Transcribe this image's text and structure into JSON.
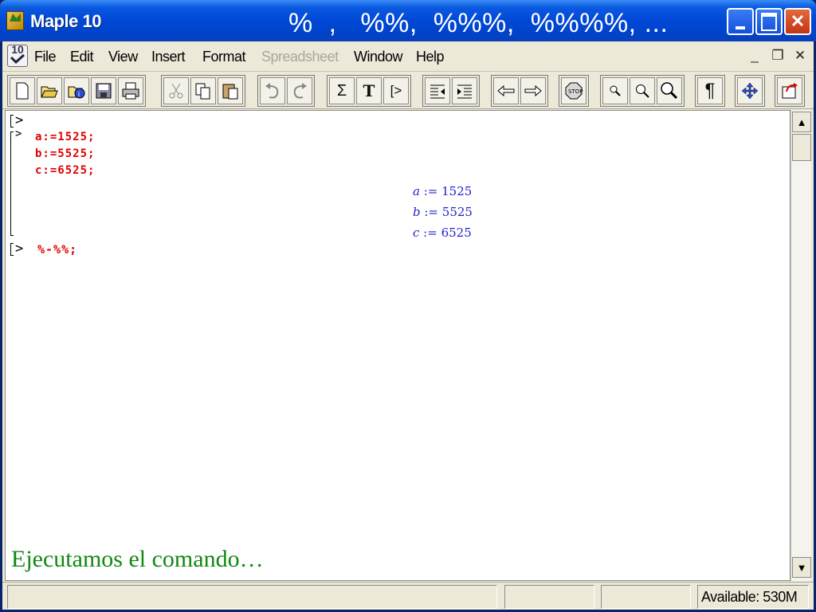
{
  "window": {
    "app_title": "Maple 10",
    "slide_title": "%  ,   %%,  %%%,  %%%%, ...",
    "app_icon_text": "10"
  },
  "menubar": {
    "logo_text": "10",
    "items": [
      {
        "label": "File",
        "enabled": true
      },
      {
        "label": "Edit",
        "enabled": true
      },
      {
        "label": "View",
        "enabled": true
      },
      {
        "label": "Insert",
        "enabled": true
      },
      {
        "label": "Format",
        "enabled": true
      },
      {
        "label": "Spreadsheet",
        "enabled": false
      },
      {
        "label": "Window",
        "enabled": true
      },
      {
        "label": "Help",
        "enabled": true
      }
    ],
    "mdi_controls": [
      "_",
      "❐",
      "✕"
    ]
  },
  "toolbar": {
    "groups": [
      [
        "new-icon",
        "open-icon",
        "open-url-icon",
        "save-icon",
        "print-icon"
      ],
      [
        "cut-icon",
        "copy-icon",
        "paste-icon"
      ],
      [
        "undo-icon",
        "redo-icon"
      ],
      [
        "math-sigma-icon",
        "text-t-icon",
        "insert-prompt-icon"
      ],
      [
        "outdent-icon",
        "indent-icon"
      ],
      [
        "back-arrow-icon",
        "forward-arrow-icon"
      ],
      [
        "stop-icon"
      ],
      [
        "zoom-small-icon",
        "zoom-medium-icon",
        "zoom-large-icon"
      ],
      [
        "pilcrow-icon"
      ],
      [
        "move-icon"
      ],
      [
        "restart-icon"
      ]
    ],
    "glyphs": {
      "math": "Σ",
      "text": "T",
      "prompt": "[>",
      "pilcrow": "¶"
    }
  },
  "worksheet": {
    "prompt_symbol": ">",
    "input_lines": [
      "a:=1525;",
      "b:=5525;",
      "c:=6525;"
    ],
    "outputs": [
      {
        "var": "a",
        "op": " := ",
        "val": "1525"
      },
      {
        "var": "b",
        "op": " := ",
        "val": "5525"
      },
      {
        "var": "c",
        "op": " := ",
        "val": "6525"
      }
    ],
    "current_input": "%-%%;",
    "caption": "Ejecutamos el comando…"
  },
  "statusbar": {
    "panel1": "",
    "panel2": "",
    "panel3": "",
    "memory": "Available: 530M"
  },
  "colors": {
    "titlebar": "#0047d6",
    "input_text": "#e00000",
    "output_text": "#2222cc",
    "caption": "#118811"
  }
}
